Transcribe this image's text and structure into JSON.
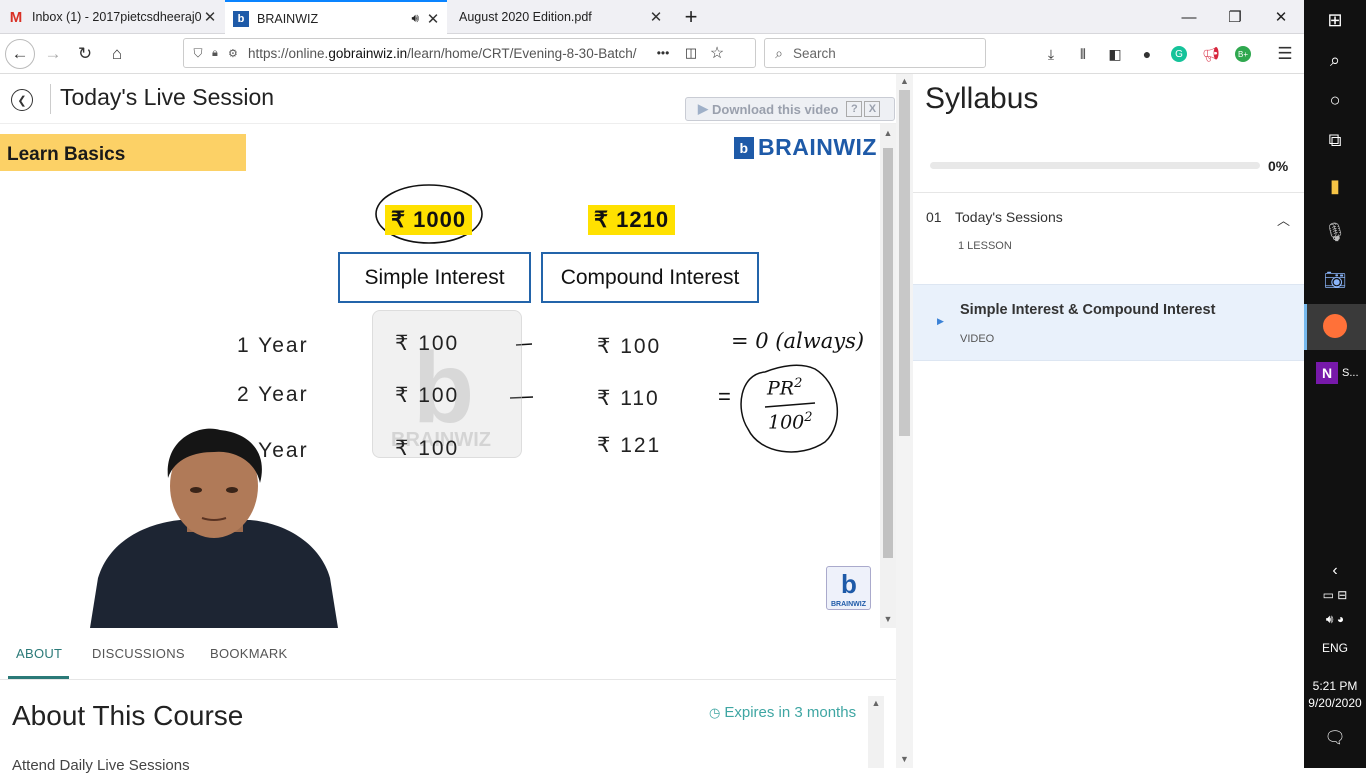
{
  "browser": {
    "tabs": [
      {
        "title": "Inbox (1) - 2017pietcsdheeraj03",
        "favicon": "gmail-icon"
      },
      {
        "title": "BRAINWIZ",
        "favicon": "brainwiz-icon",
        "active": true,
        "audio": true
      },
      {
        "title": "August 2020 Edition.pdf",
        "favicon": "pdf-icon"
      }
    ],
    "new_tab": "+",
    "url_prefix": "https://online.",
    "url_domain": "gobrainwiz.in",
    "url_path": "/learn/home/CRT/Evening-8-30-Batch/",
    "url_more": "•••",
    "search_placeholder": "Search"
  },
  "page": {
    "back_icon": "back-circle-icon",
    "session_title": "Today's Live Session",
    "download_label": "Download this video",
    "download_help": "?",
    "download_close": "X"
  },
  "video": {
    "banner": "Learn Basics",
    "brand": "BRAINWIZ",
    "brand_letter": "b",
    "principal_si": "₹ 1000",
    "principal_ci": "₹ 1210",
    "header_si": "Simple Interest",
    "header_ci": "Compound Interest",
    "rows": [
      {
        "label": "1 Year",
        "si": "₹ 100",
        "ci": "₹ 100"
      },
      {
        "label": "2 Year",
        "si": "₹ 100",
        "ci": "₹ 110"
      },
      {
        "label": "3 Year",
        "si": "₹ 100",
        "ci": "₹ 121"
      }
    ],
    "note_always": "= 0 (always)",
    "note_formula_top": "PR",
    "note_formula_exp": "2",
    "note_formula_bottom": "100",
    "note_equals": "=",
    "watermark_text": "BRAINWIZ",
    "corner_logo_text": "BRAINWIZ"
  },
  "course_tabs": [
    {
      "label": "ABOUT",
      "active": true
    },
    {
      "label": "DISCUSSIONS"
    },
    {
      "label": "BOOKMARK"
    }
  ],
  "about": {
    "title": "About This Course",
    "expires": "Expires in 3 months",
    "description": "Attend Daily Live Sessions"
  },
  "syllabus": {
    "title": "Syllabus",
    "progress_percent": 0,
    "progress_label": "0%",
    "section_number": "01",
    "section_name": "Today's Sessions",
    "section_count": "1 LESSON",
    "lessons": [
      {
        "title": "Simple Interest & Compound Interest",
        "type": "VIDEO"
      }
    ]
  },
  "taskbar": {
    "onenote_label": "S...",
    "language": "ENG",
    "time": "5:21 PM",
    "date": "9/20/2020"
  },
  "colors": {
    "accent_teal": "#3fa6a3",
    "brand_blue": "#1e5aa8",
    "banner_yellow": "#fcd166",
    "highlight_yellow": "#ffe100",
    "lesson_bg": "#e9f1fb"
  }
}
